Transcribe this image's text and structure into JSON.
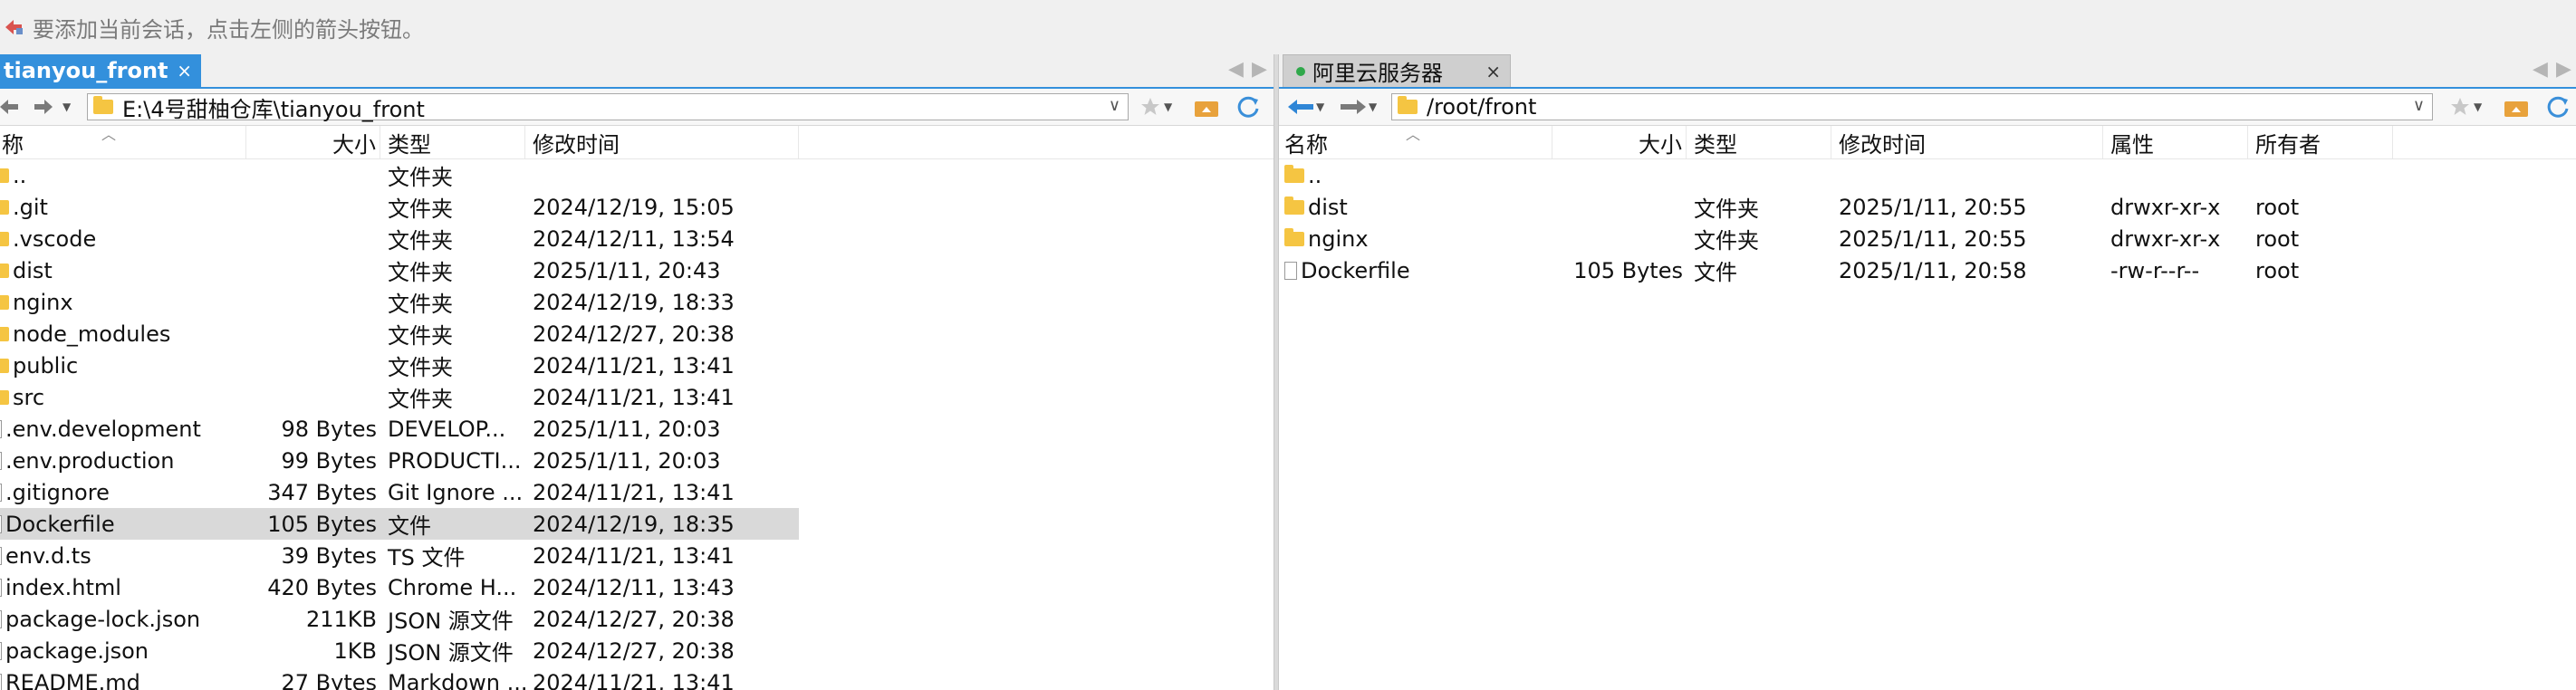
{
  "hint": {
    "text": "要添加当前会话，点击左侧的箭头按钮。"
  },
  "left": {
    "tab": {
      "label": "tianyou_front",
      "close": "×"
    },
    "path": "E:\\4号甜柚仓库\\tianyou_front",
    "columns": {
      "name": "称",
      "size": "大小",
      "type": "类型",
      "modified": "修改时间"
    },
    "rows": [
      {
        "name": "..",
        "size": "",
        "type": "文件夹",
        "modified": "",
        "kind": "folder"
      },
      {
        "name": ".git",
        "size": "",
        "type": "文件夹",
        "modified": "2024/12/19, 15:05",
        "kind": "folder"
      },
      {
        "name": ".vscode",
        "size": "",
        "type": "文件夹",
        "modified": "2024/12/11, 13:54",
        "kind": "folder"
      },
      {
        "name": "dist",
        "size": "",
        "type": "文件夹",
        "modified": "2025/1/11, 20:43",
        "kind": "folder"
      },
      {
        "name": "nginx",
        "size": "",
        "type": "文件夹",
        "modified": "2024/12/19, 18:33",
        "kind": "folder"
      },
      {
        "name": "node_modules",
        "size": "",
        "type": "文件夹",
        "modified": "2024/12/27, 20:38",
        "kind": "folder"
      },
      {
        "name": "public",
        "size": "",
        "type": "文件夹",
        "modified": "2024/11/21, 13:41",
        "kind": "folder"
      },
      {
        "name": "src",
        "size": "",
        "type": "文件夹",
        "modified": "2024/11/21, 13:41",
        "kind": "folder"
      },
      {
        "name": ".env.development",
        "size": "98 Bytes",
        "type": "DEVELOP...",
        "modified": "2025/1/11, 20:03",
        "kind": "file"
      },
      {
        "name": ".env.production",
        "size": "99 Bytes",
        "type": "PRODUCTI...",
        "modified": "2025/1/11, 20:03",
        "kind": "file"
      },
      {
        "name": ".gitignore",
        "size": "347 Bytes",
        "type": "Git Ignore ...",
        "modified": "2024/11/21, 13:41",
        "kind": "file"
      },
      {
        "name": "Dockerfile",
        "size": "105 Bytes",
        "type": "文件",
        "modified": "2024/12/19, 18:35",
        "kind": "file",
        "selected": true
      },
      {
        "name": "env.d.ts",
        "size": "39 Bytes",
        "type": "TS 文件",
        "modified": "2024/11/21, 13:41",
        "kind": "file"
      },
      {
        "name": "index.html",
        "size": "420 Bytes",
        "type": "Chrome H...",
        "modified": "2024/12/11, 13:43",
        "kind": "file"
      },
      {
        "name": "package-lock.json",
        "size": "211KB",
        "type": "JSON 源文件",
        "modified": "2024/12/27, 20:38",
        "kind": "file"
      },
      {
        "name": "package.json",
        "size": "1KB",
        "type": "JSON 源文件",
        "modified": "2024/12/27, 20:38",
        "kind": "file"
      },
      {
        "name": "README.md",
        "size": "27 Bytes",
        "type": "Markdown ...",
        "modified": "2024/11/21, 13:41",
        "kind": "file"
      }
    ]
  },
  "right": {
    "tab": {
      "label": "阿里云服务器",
      "close": "×"
    },
    "path": "/root/front",
    "columns": {
      "name": "名称",
      "size": "大小",
      "type": "类型",
      "modified": "修改时间",
      "attrs": "属性",
      "owner": "所有者"
    },
    "rows": [
      {
        "name": "..",
        "size": "",
        "type": "",
        "modified": "",
        "attrs": "",
        "owner": "",
        "kind": "folder"
      },
      {
        "name": "dist",
        "size": "",
        "type": "文件夹",
        "modified": "2025/1/11, 20:55",
        "attrs": "drwxr-xr-x",
        "owner": "root",
        "kind": "folder"
      },
      {
        "name": "nginx",
        "size": "",
        "type": "文件夹",
        "modified": "2025/1/11, 20:55",
        "attrs": "drwxr-xr-x",
        "owner": "root",
        "kind": "folder"
      },
      {
        "name": "Dockerfile",
        "size": "105 Bytes",
        "type": "文件",
        "modified": "2025/1/11, 20:58",
        "attrs": "-rw-r--r--",
        "owner": "root",
        "kind": "file"
      }
    ]
  },
  "colors": {
    "accent": "#3390dc",
    "folder": "#f5c542",
    "connected": "#2fa84a",
    "selection": "#d9d9d9"
  }
}
